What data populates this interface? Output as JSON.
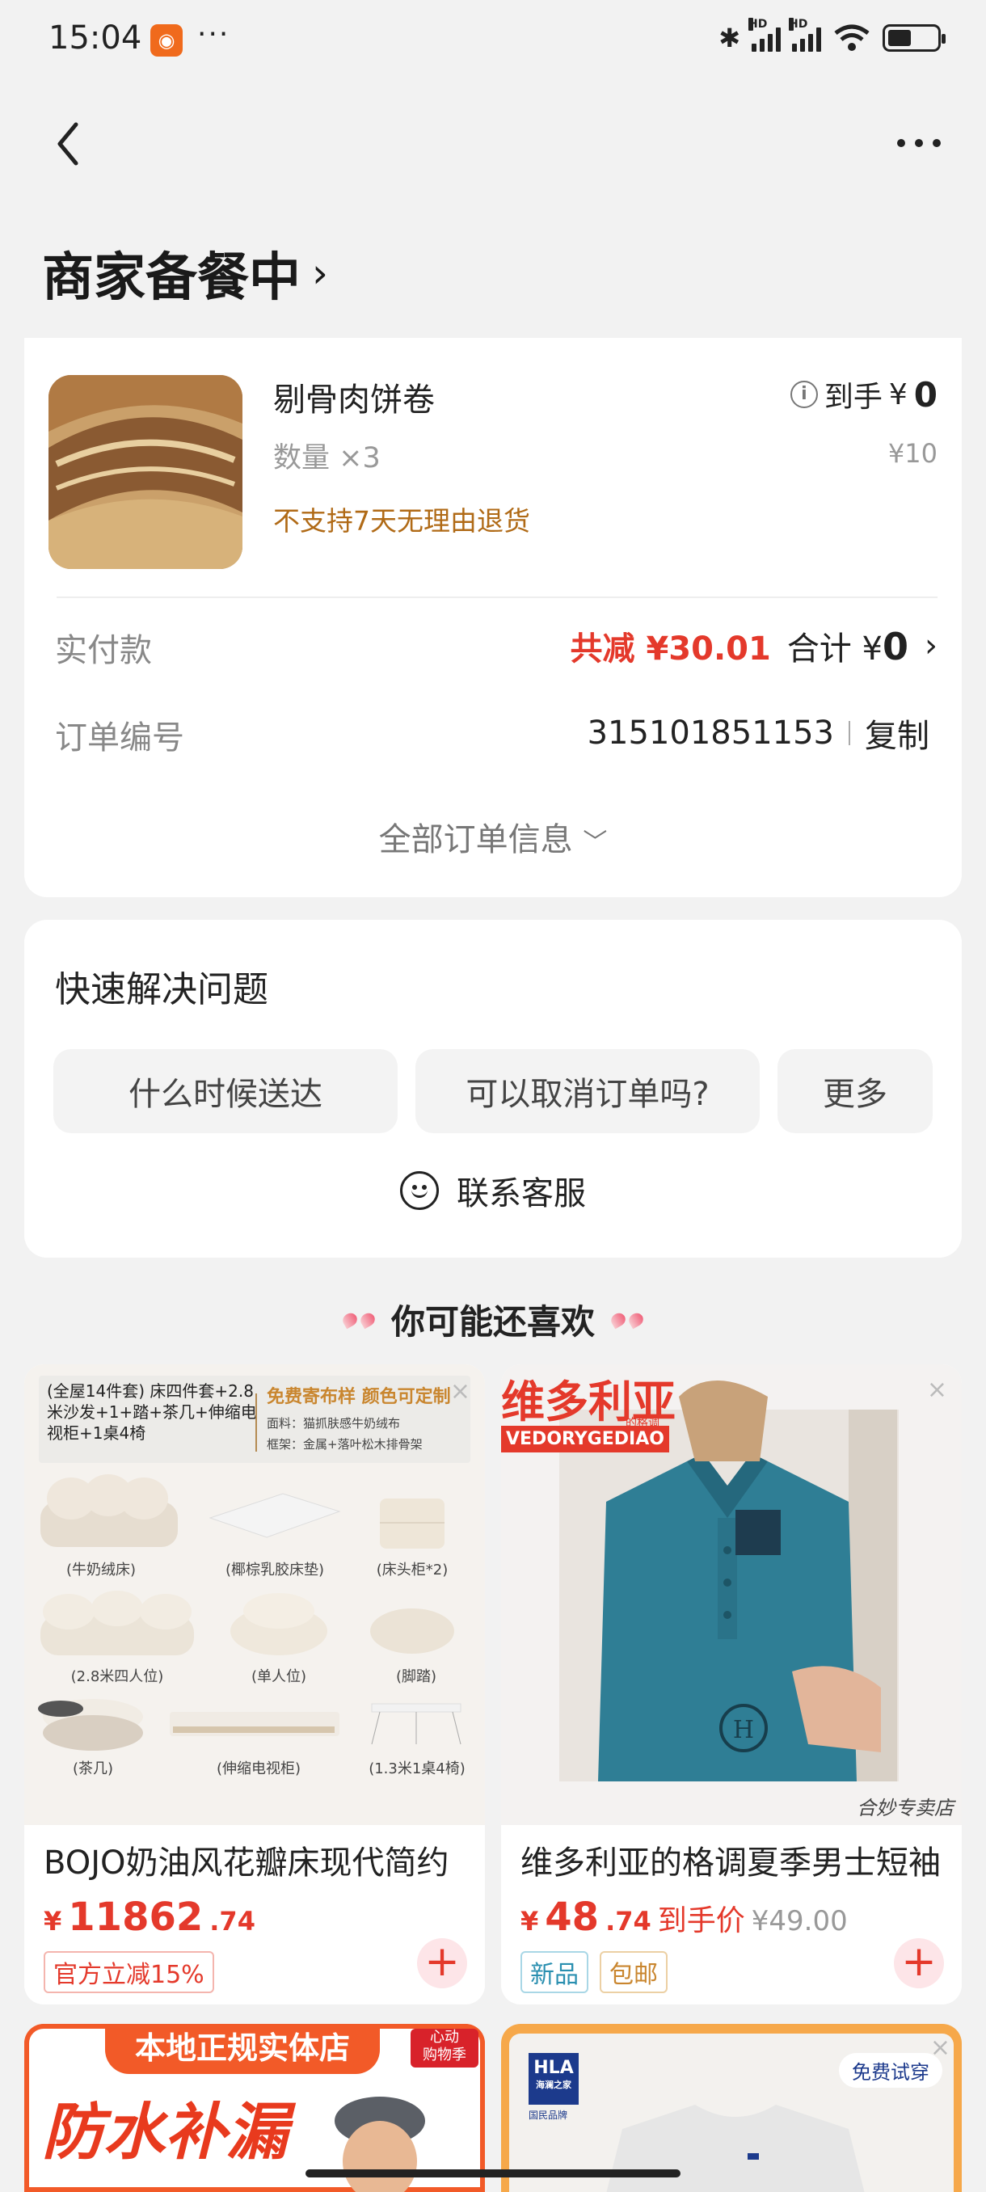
{
  "status_bar": {
    "time": "15:04",
    "dots": "···"
  },
  "header": {
    "title": "商家备餐中",
    "title_chevron": "›"
  },
  "order": {
    "product_name": "剔骨肉饼卷",
    "quantity": "数量 ×3",
    "policy": "不支持7天无理由退货",
    "price_label": "到手",
    "price_symbol": "¥",
    "price_value": "0",
    "original_price": "¥10",
    "pay_label": "实付款",
    "discount": "共减 ¥30.01",
    "total_label": "合计 ¥",
    "total_value": "0",
    "order_no_label": "订单编号",
    "order_no": "315101851153",
    "copy": "复制",
    "all_info": "全部订单信息"
  },
  "quick": {
    "title": "快速解决问题",
    "buttons": [
      "什么时候送达",
      "可以取消订单吗?",
      "更多"
    ],
    "contact": "联系客服"
  },
  "recommend": {
    "heading": "你可能还喜欢",
    "items": [
      {
        "banner_title": "(全屋14件套) 床四件套+2.8米沙发+1+踏+茶几+伸缩电视柜+1桌4椅",
        "banner_promo": "免费寄布样 颜色可定制",
        "banner_spec1": "面料：猫抓肤感牛奶绒布",
        "banner_spec2": "框架：金属+落叶松木排骨架",
        "captions": [
          "(牛奶绒床)",
          "(椰棕乳胶床垫)",
          "(床头柜*2)",
          "(2.8米四人位)",
          "(单人位)",
          "(脚踏)",
          "(茶几)",
          "(伸缩电视柜)",
          "(1.3米1桌4椅)"
        ],
        "title": "BOJO奶油风花瓣床现代简约",
        "price_symbol": "¥",
        "price_int": "11862",
        "price_dec": ".74",
        "tags": [
          "官方立减15%"
        ]
      },
      {
        "brand": "维多利亚",
        "brand_sub": "的格调",
        "brand_en": "VEDORYGEDIAO",
        "shop": "合妙专卖店",
        "title": "维多利亚的格调夏季男士短袖",
        "price_symbol": "¥",
        "price_int": "48",
        "price_dec": ".74",
        "price_label": "到手价",
        "orig_price": "¥49.00",
        "tags": [
          "新品",
          "包邮"
        ]
      }
    ],
    "bottom_left": {
      "banner": "本地正规实体店",
      "badge": "心动\n购物季",
      "headline": "防水补漏"
    },
    "bottom_right": {
      "brand": "HLA",
      "brand_cn": "海澜之家",
      "brand_sub": "国民品牌",
      "trial": "免费试穿"
    }
  },
  "colors": {
    "accent_red": "#e4392b",
    "policy_orange": "#b06a16",
    "background": "#f2f2f2"
  }
}
